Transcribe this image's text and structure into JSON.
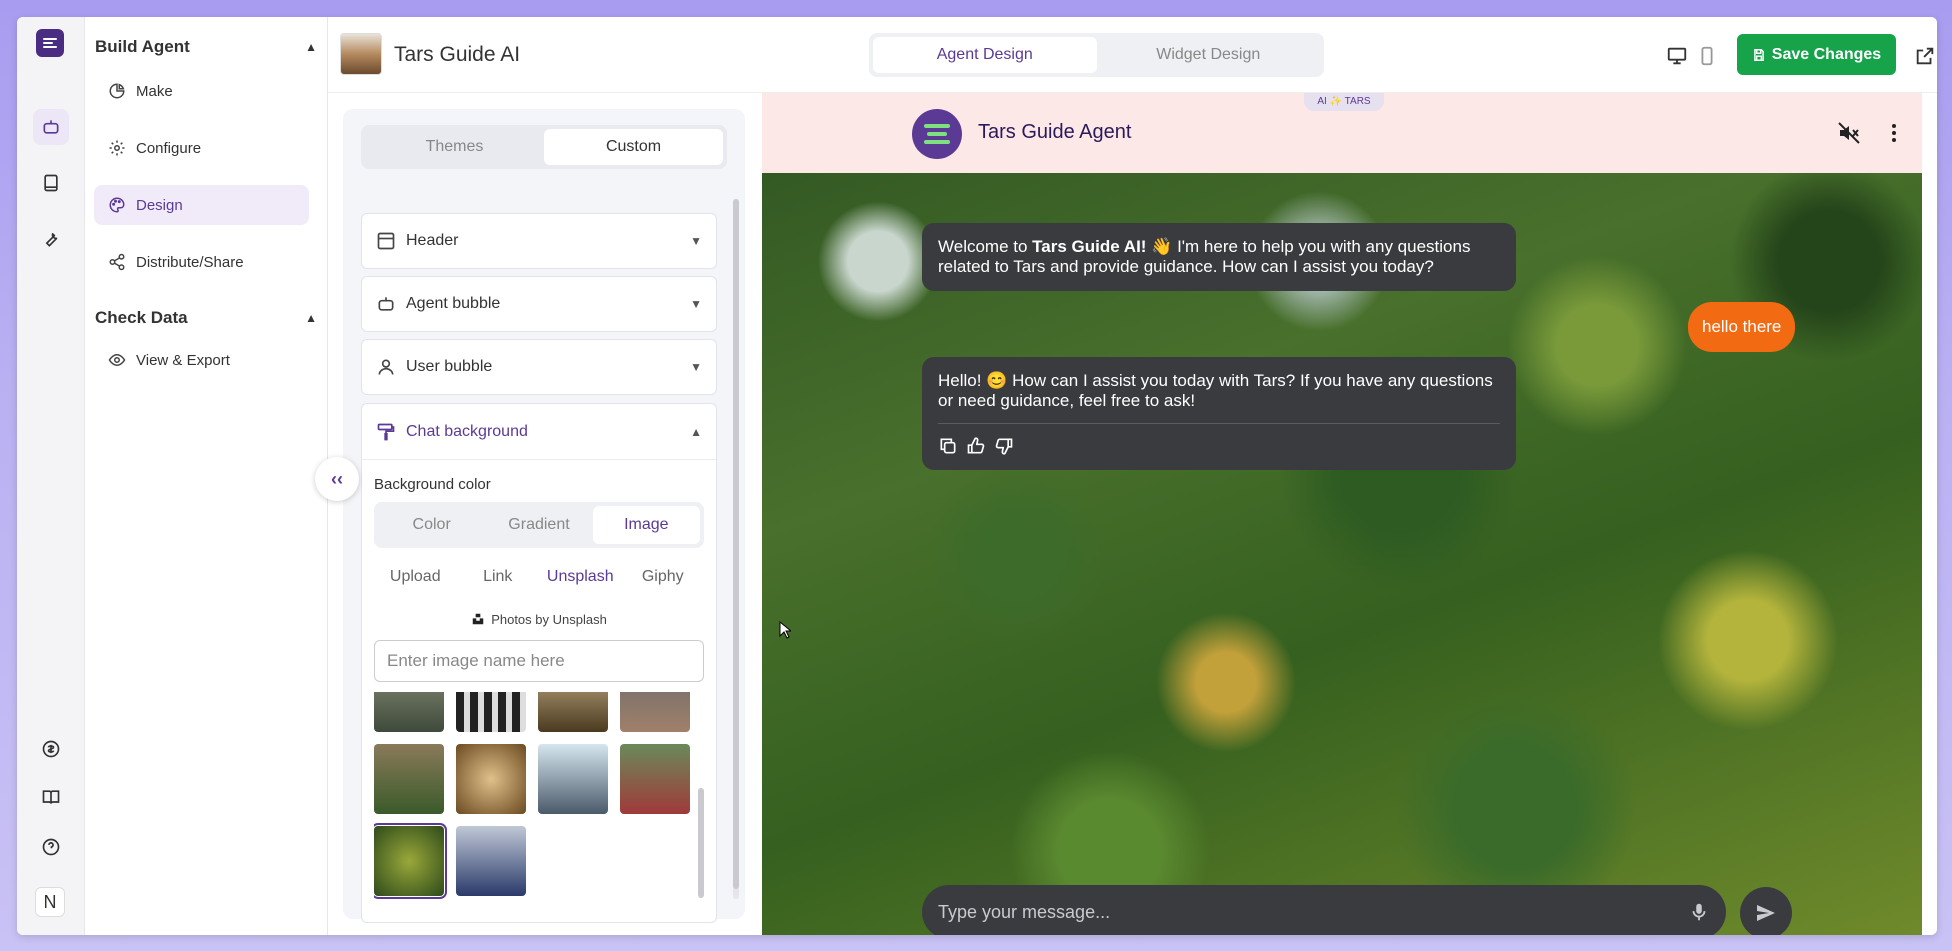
{
  "rail": {
    "avatar_letter": "N"
  },
  "sidebar": {
    "build_section": "Build Agent",
    "build_items": [
      {
        "label": "Make",
        "icon": "pie-chart-icon"
      },
      {
        "label": "Configure",
        "icon": "gear-icon"
      },
      {
        "label": "Design",
        "icon": "palette-icon"
      },
      {
        "label": "Distribute/Share",
        "icon": "share-icon"
      }
    ],
    "data_section": "Check Data",
    "data_items": [
      {
        "label": "View & Export",
        "icon": "eye-icon"
      }
    ]
  },
  "topbar": {
    "agent_title": "Tars Guide AI",
    "tabs": [
      "Agent Design",
      "Widget Design"
    ],
    "active_tab": "Agent Design",
    "save_label": "Save Changes"
  },
  "panel": {
    "tabs": [
      "Themes",
      "Custom"
    ],
    "active_tab": "Custom",
    "sections": [
      "Header",
      "Agent bubble",
      "User bubble",
      "Chat background"
    ],
    "open_section": "Chat background",
    "bg_label": "Background color",
    "bg_modes": [
      "Color",
      "Gradient",
      "Image"
    ],
    "active_mode": "Image",
    "sources": [
      "Upload",
      "Link",
      "Unsplash",
      "Giphy"
    ],
    "active_source": "Unsplash",
    "credit": "Photos by Unsplash",
    "search_placeholder": "Enter image name here"
  },
  "preview": {
    "brand_pill": "AI ✨ TARS",
    "bot_name": "Tars Guide Agent",
    "messages": [
      {
        "from": "bot",
        "text_before": "Welcome to ",
        "bold": "Tars Guide AI!",
        "text_after": " 👋 I'm here to help you with any questions related to Tars and provide guidance. How can I assist you today?"
      },
      {
        "from": "user",
        "text": "hello there"
      },
      {
        "from": "bot",
        "text": "Hello! 😊 How can I assist you today with Tars? If you have any questions or need guidance, feel free to ask!"
      }
    ],
    "composer_placeholder": "Type your message..."
  },
  "colors": {
    "brand": "#5b3a95",
    "save": "#16a34a",
    "user_bubble": "#f26a12",
    "bot_bubble": "#3a3b3f",
    "chat_header": "#fde8e8"
  }
}
